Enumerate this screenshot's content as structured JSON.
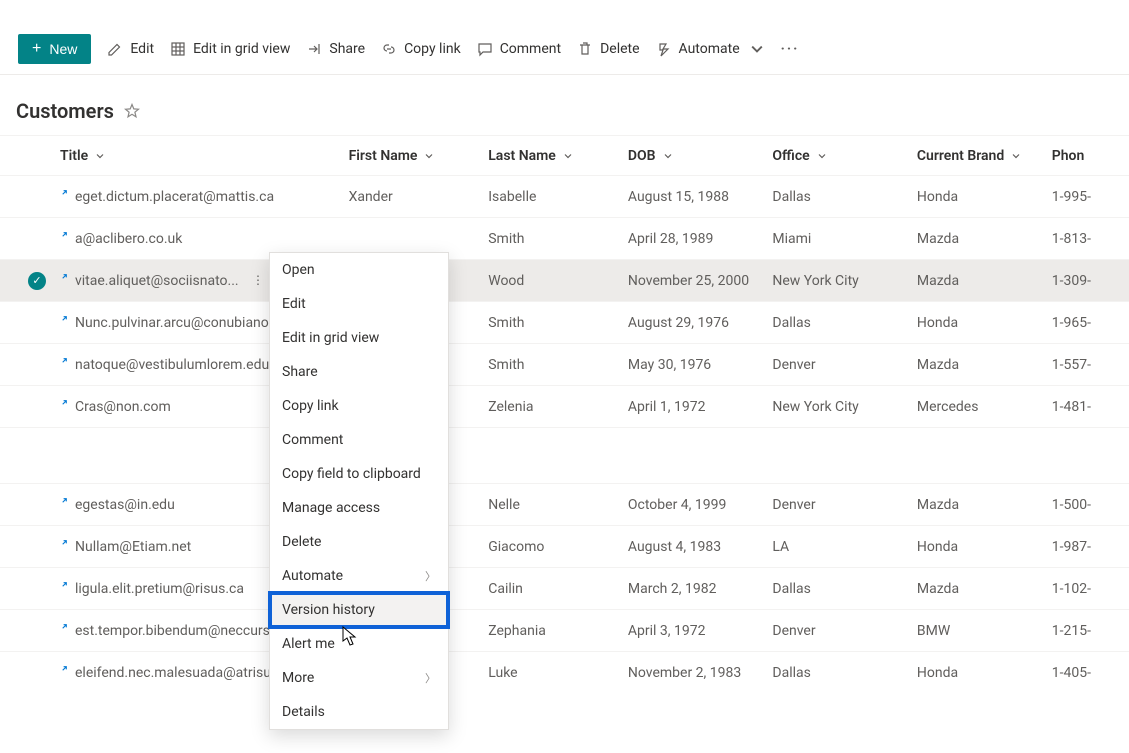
{
  "toolbar": {
    "new_label": "New",
    "edit_label": "Edit",
    "edit_grid_label": "Edit in grid view",
    "share_label": "Share",
    "copy_link_label": "Copy link",
    "comment_label": "Comment",
    "delete_label": "Delete",
    "automate_label": "Automate"
  },
  "list": {
    "title": "Customers"
  },
  "columns": {
    "title": "Title",
    "first_name": "First Name",
    "last_name": "Last Name",
    "dob": "DOB",
    "office": "Office",
    "brand": "Current Brand",
    "phone": "Phon"
  },
  "rows": [
    {
      "title": "eget.dictum.placerat@mattis.ca",
      "first": "Xander",
      "last": "Isabelle",
      "dob": "August 15, 1988",
      "office": "Dallas",
      "brand": "Honda",
      "phone": "1-995-"
    },
    {
      "title": "a@aclibero.co.uk",
      "first": "",
      "last": "Smith",
      "dob": "April 28, 1989",
      "office": "Miami",
      "brand": "Mazda",
      "phone": "1-813-"
    },
    {
      "title": "vitae.aliquet@sociisnato...",
      "first": "",
      "last": "Wood",
      "dob": "November 25, 2000",
      "office": "New York City",
      "brand": "Mazda",
      "phone": "1-309-"
    },
    {
      "title": "Nunc.pulvinar.arcu@conubianostr",
      "first": "",
      "last": "Smith",
      "dob": "August 29, 1976",
      "office": "Dallas",
      "brand": "Honda",
      "phone": "1-965-"
    },
    {
      "title": "natoque@vestibulumlorem.edu",
      "first": "",
      "last": "Smith",
      "dob": "May 30, 1976",
      "office": "Denver",
      "brand": "Mazda",
      "phone": "1-557-"
    },
    {
      "title": "Cras@non.com",
      "first": "",
      "last": "Zelenia",
      "dob": "April 1, 1972",
      "office": "New York City",
      "brand": "Mercedes",
      "phone": "1-481-"
    },
    {
      "title": "egestas@in.edu",
      "first": "",
      "last": "Nelle",
      "dob": "October 4, 1999",
      "office": "Denver",
      "brand": "Mazda",
      "phone": "1-500-"
    },
    {
      "title": "Nullam@Etiam.net",
      "first": "",
      "last": "Giacomo",
      "dob": "August 4, 1983",
      "office": "LA",
      "brand": "Honda",
      "phone": "1-987-"
    },
    {
      "title": "ligula.elit.pretium@risus.ca",
      "first": "",
      "last": "Cailin",
      "dob": "March 2, 1982",
      "office": "Dallas",
      "brand": "Mazda",
      "phone": "1-102-"
    },
    {
      "title": "est.tempor.bibendum@neccursus",
      "first": "",
      "last": "Zephania",
      "dob": "April 3, 1972",
      "office": "Denver",
      "brand": "BMW",
      "phone": "1-215-"
    },
    {
      "title": "eleifend.nec.malesuada@atrisus.c",
      "first": "",
      "last": "Luke",
      "dob": "November 2, 1983",
      "office": "Dallas",
      "brand": "Honda",
      "phone": "1-405-"
    }
  ],
  "context_menu": {
    "open": "Open",
    "edit": "Edit",
    "edit_grid": "Edit in grid view",
    "share": "Share",
    "copy_link": "Copy link",
    "comment": "Comment",
    "copy_field": "Copy field to clipboard",
    "manage_access": "Manage access",
    "delete": "Delete",
    "automate": "Automate",
    "version_history": "Version history",
    "alert_me": "Alert me",
    "more": "More",
    "details": "Details"
  }
}
